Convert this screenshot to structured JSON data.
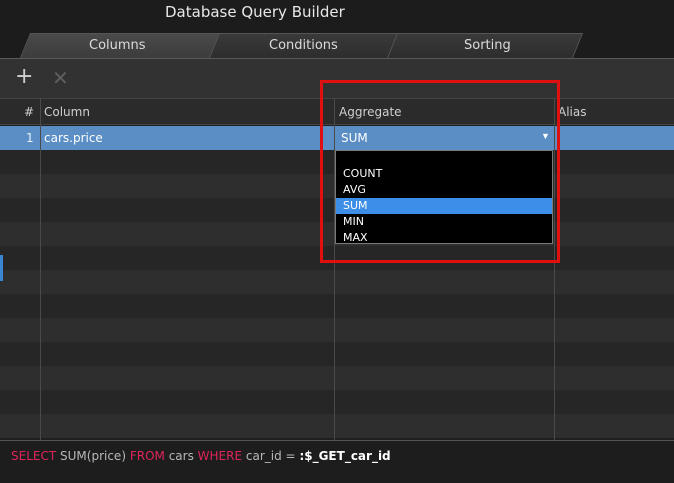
{
  "window": {
    "title": "Database Query Builder"
  },
  "tabs": [
    {
      "label": "Columns",
      "active": true
    },
    {
      "label": "Conditions",
      "active": false
    },
    {
      "label": "Sorting",
      "active": false
    }
  ],
  "toolbar": {
    "add_icon": "plus-icon",
    "remove_icon": "close-icon"
  },
  "grid": {
    "headers": {
      "num": "#",
      "column": "Column",
      "aggregate": "Aggregate",
      "alias": "Alias"
    },
    "rows": [
      {
        "num": "1",
        "column": "cars.price",
        "aggregate": "SUM",
        "alias": ""
      }
    ]
  },
  "dropdown": {
    "options": [
      "",
      "COUNT",
      "AVG",
      "SUM",
      "MIN",
      "MAX"
    ],
    "selected": "SUM"
  },
  "sql": {
    "select_kw": "SELECT",
    "expr": "SUM(price)",
    "from_kw": "FROM",
    "table": "cars",
    "where_kw": "WHERE",
    "condition": "car_id =",
    "param": ":$_GET_car_id"
  },
  "colors": {
    "selected_row": "#5a8ec4",
    "highlight_box": "#e01010",
    "keyword": "#e0245a"
  }
}
